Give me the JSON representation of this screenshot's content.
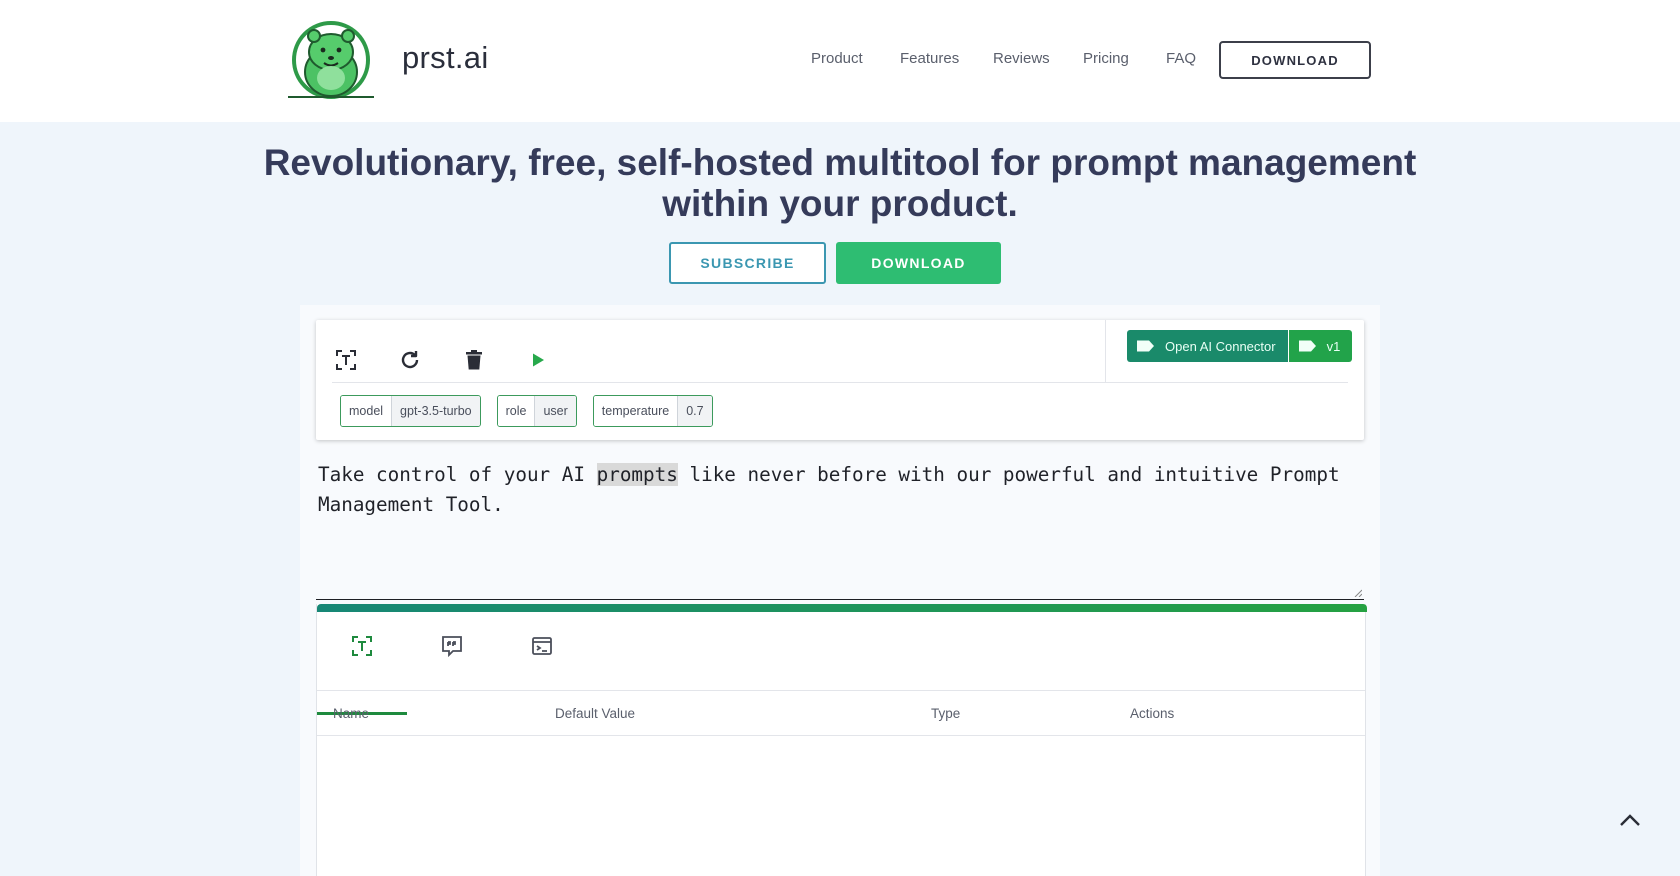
{
  "brand": {
    "name": "prst.ai"
  },
  "nav": {
    "product": "Product",
    "features": "Features",
    "reviews": "Reviews",
    "pricing": "Pricing",
    "faq": "FAQ",
    "download": "DOWNLOAD"
  },
  "hero": {
    "title": "Revolutionary, free, self-hosted multitool for prompt management within your product.",
    "subscribe": "SUBSCRIBE",
    "download": "DOWNLOAD"
  },
  "toolbar": {
    "icons": [
      "text-select-icon",
      "refresh-icon",
      "trash-icon",
      "play-icon"
    ],
    "connector": {
      "name": "Open AI Connector",
      "version": "v1"
    },
    "params": [
      {
        "key": "model",
        "value": "gpt-3.5-turbo"
      },
      {
        "key": "role",
        "value": "user"
      },
      {
        "key": "temperature",
        "value": "0.7"
      }
    ]
  },
  "prompt": {
    "before": "Take control of your AI ",
    "highlight": "prompts",
    "after": " like never before with our powerful and intuitive Prompt Management Tool."
  },
  "tabs": {
    "icons": [
      "text-select-icon",
      "quote-message-icon",
      "terminal-icon"
    ],
    "active_index": 0
  },
  "table": {
    "headers": {
      "name": "Name",
      "default_value": "Default Value",
      "type": "Type",
      "actions": "Actions"
    }
  },
  "colors": {
    "primary_green": "#2ebd72",
    "teal": "#1a8a6a",
    "outline_blue": "#3b97b1",
    "heading": "#353b5a"
  }
}
